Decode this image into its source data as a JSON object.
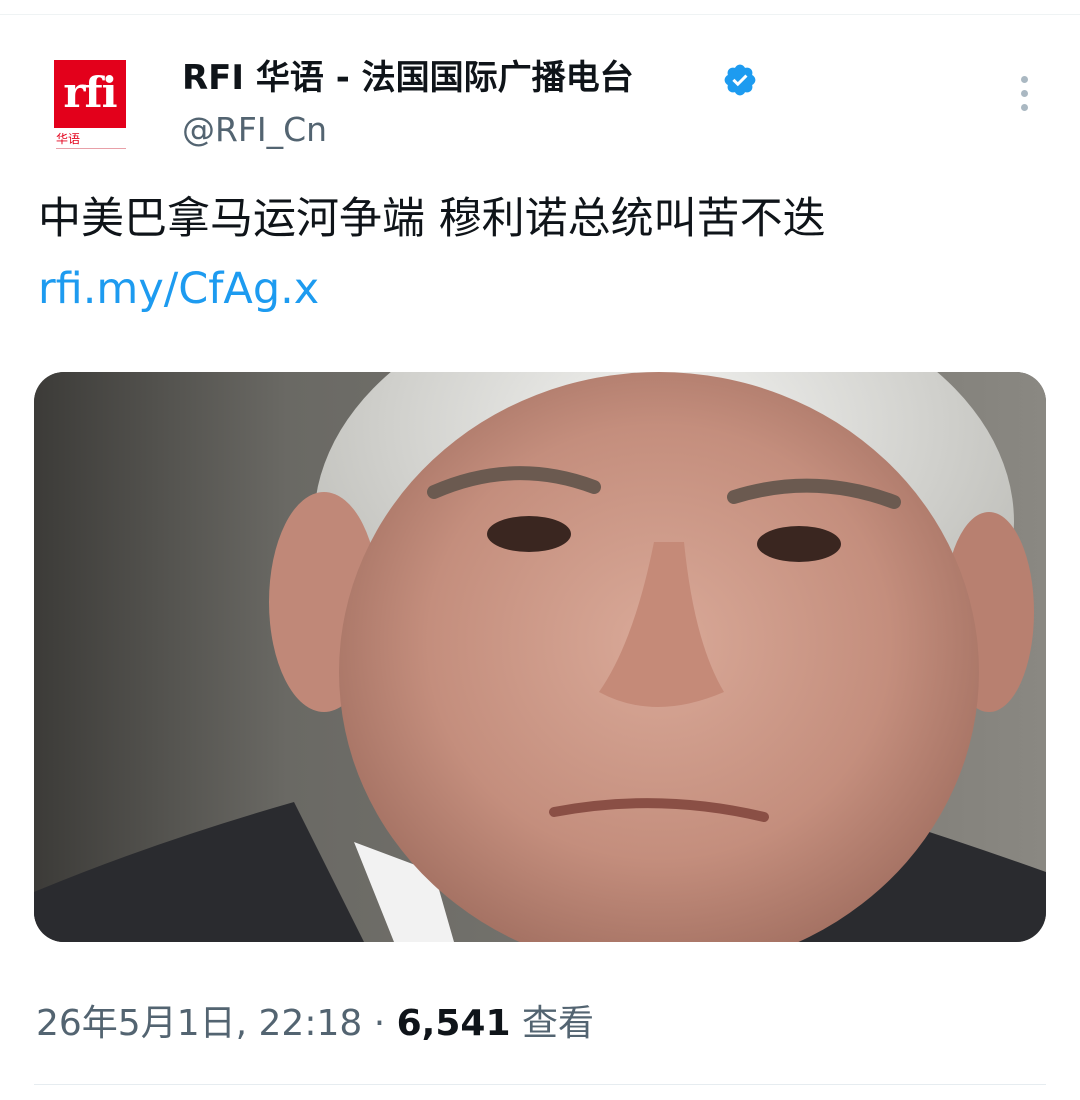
{
  "account": {
    "display_name": "RFI 华语 - 法国国际广播电台",
    "handle": "@RFI_Cn",
    "verified": true,
    "avatar_logo_text": "rfi",
    "avatar_sub_text": "华语"
  },
  "tweet": {
    "text": "中美巴拿马运河争端 穆利诺总统叫苦不迭",
    "link": "rfi.my/CfAg.x"
  },
  "media": {
    "subject": "photo"
  },
  "meta": {
    "timestamp": "26年5月1日, 22:18",
    "separator": "·",
    "views_count": "6,541",
    "views_label": "查看"
  },
  "colors": {
    "link": "#1d9bf0",
    "verified": "#1d9bf0",
    "text": "#0f1419",
    "secondary": "#536471",
    "brand_red": "#e3001b"
  },
  "icons": {
    "verified": "verified-badge-icon",
    "more": "more-vertical-icon"
  }
}
